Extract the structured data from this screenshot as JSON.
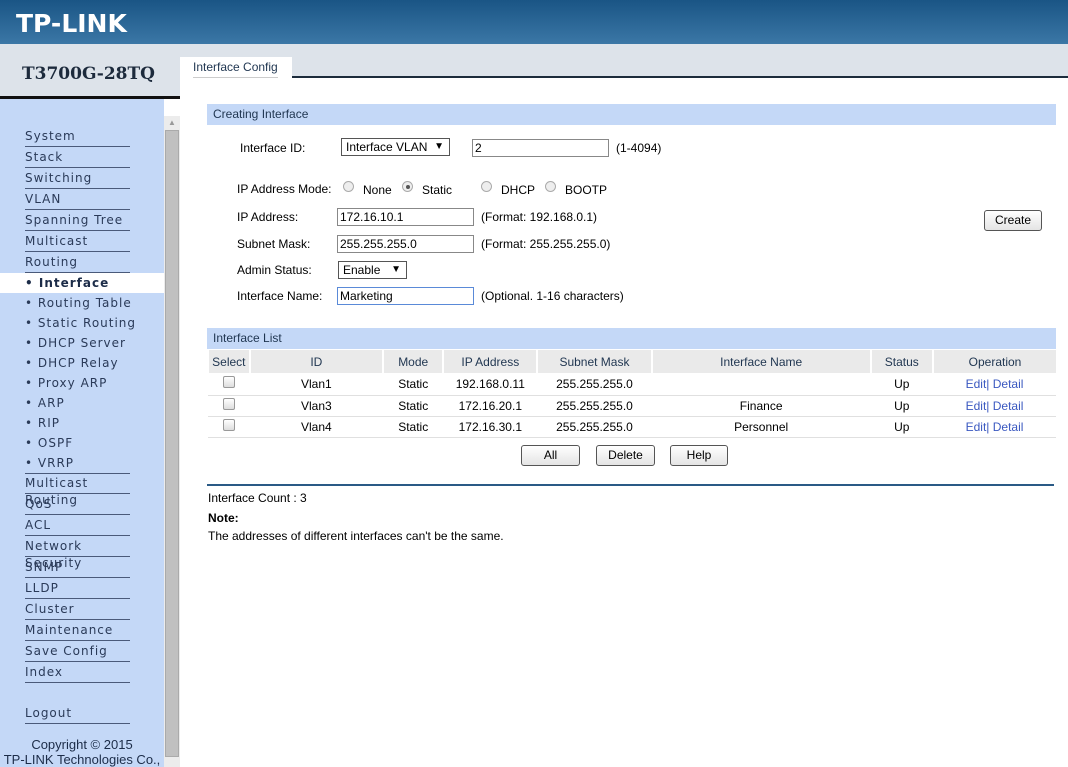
{
  "header": {
    "logo": "TP-LINK"
  },
  "model": "T3700G-28TQ",
  "tab": "Interface Config",
  "sidebar": {
    "items": [
      "System",
      "Stack",
      "Switching",
      "VLAN",
      "Spanning Tree",
      "Multicast",
      "Routing"
    ],
    "sub_items": [
      "• Interface",
      "• Routing Table",
      "• Static Routing",
      "• DHCP Server",
      "• DHCP Relay",
      "• Proxy ARP",
      "• ARP",
      "• RIP",
      "• OSPF",
      "• VRRP"
    ],
    "items2": [
      "Multicast Routing",
      "QoS",
      "ACL",
      "Network Security",
      "SNMP",
      "LLDP",
      "Cluster",
      "Maintenance",
      "Save Config",
      "Index"
    ],
    "logout": "Logout",
    "copyright1": "Copyright © 2015",
    "copyright2": "TP-LINK Technologies Co.,"
  },
  "create": {
    "title": "Creating Interface",
    "id_label": "Interface ID:",
    "id_type": "Interface VLAN",
    "id_value": "2",
    "id_range": "(1-4094)",
    "mode_label": "IP Address Mode:",
    "modes": [
      "None",
      "Static",
      "DHCP",
      "BOOTP"
    ],
    "selected_mode": "Static",
    "ip_label": "IP Address:",
    "ip_value": "172.16.10.1",
    "ip_hint": "(Format: 192.168.0.1)",
    "mask_label": "Subnet Mask:",
    "mask_value": "255.255.255.0",
    "mask_hint": "(Format: 255.255.255.0)",
    "admin_label": "Admin Status:",
    "admin_value": "Enable",
    "name_label": "Interface Name:",
    "name_value": "Marketing",
    "name_hint": "(Optional. 1-16 characters)",
    "create_btn": "Create"
  },
  "list": {
    "title": "Interface List",
    "columns": [
      "Select",
      "ID",
      "Mode",
      "IP Address",
      "Subnet Mask",
      "Interface Name",
      "Status",
      "Operation"
    ],
    "rows": [
      {
        "id": "Vlan1",
        "mode": "Static",
        "ip": "192.168.0.11",
        "mask": "255.255.255.0",
        "name": "",
        "status": "Up"
      },
      {
        "id": "Vlan3",
        "mode": "Static",
        "ip": "172.16.20.1",
        "mask": "255.255.255.0",
        "name": "Finance",
        "status": "Up"
      },
      {
        "id": "Vlan4",
        "mode": "Static",
        "ip": "172.16.30.1",
        "mask": "255.255.255.0",
        "name": "Personnel",
        "status": "Up"
      }
    ],
    "edit": "Edit",
    "sep": "|",
    "detail": "Detail",
    "buttons": [
      "All",
      "Delete",
      "Help"
    ]
  },
  "footer": {
    "count": "Interface Count : 3",
    "note_title": "Note:",
    "note": "The addresses of different interfaces can't be the same."
  }
}
